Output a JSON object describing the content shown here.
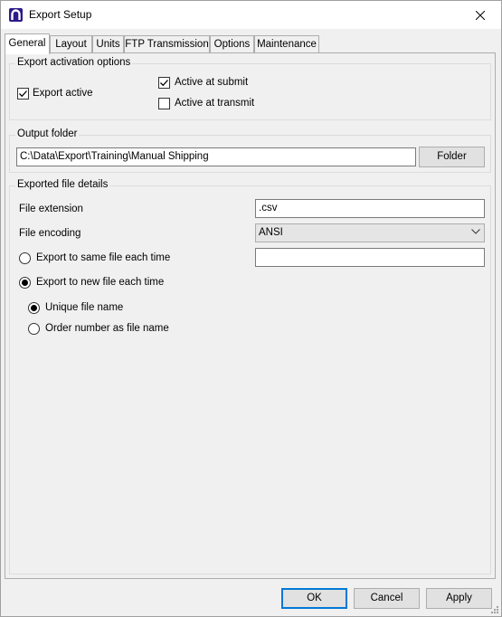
{
  "window": {
    "title": "Export Setup"
  },
  "tabs": [
    "General",
    "Layout",
    "Units",
    "FTP Transmission",
    "Options",
    "Maintenance"
  ],
  "activation": {
    "group_label": "Export activation options",
    "export_active": {
      "label": "Export active",
      "checked": true
    },
    "active_at_submit": {
      "label": "Active at submit",
      "checked": true
    },
    "active_at_transmit": {
      "label": "Active at transmit",
      "checked": false
    }
  },
  "output": {
    "group_label": "Output folder",
    "path": "C:\\Data\\Export\\Training\\Manual Shipping",
    "folder_button": "Folder"
  },
  "details": {
    "group_label": "Exported file details",
    "file_extension_label": "File extension",
    "file_extension_value": ".csv",
    "file_encoding_label": "File encoding",
    "file_encoding_value": "ANSI",
    "same_file_label": "Export to same file each time",
    "same_file_value": "",
    "new_file_label": "Export to new file each time",
    "unique_name_label": "Unique file name",
    "order_number_label": "Order number as file name"
  },
  "buttons": {
    "ok": "OK",
    "cancel": "Cancel",
    "apply": "Apply"
  },
  "colors": {
    "focus_border": "#0078d7",
    "dialog_bg": "#f0f0f0",
    "app_icon": "#2e1a8a"
  },
  "icons": [
    "app-icon",
    "close-icon",
    "checkmark-icon",
    "chevron-down-icon",
    "resize-grip-icon"
  ]
}
